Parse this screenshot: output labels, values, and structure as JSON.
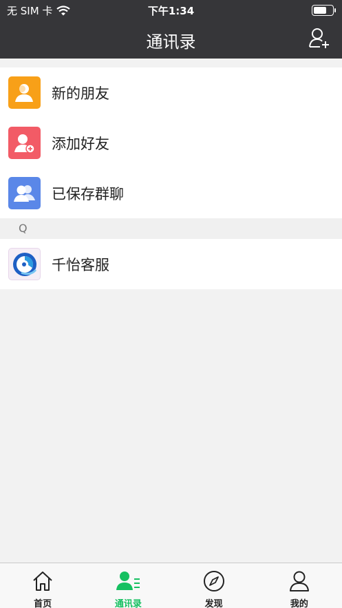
{
  "status_bar": {
    "carrier": "无 SIM 卡",
    "time": "下午1:34"
  },
  "nav": {
    "title": "通讯录",
    "add_icon": "add-contact-icon"
  },
  "contacts_menu": [
    {
      "label": "新的朋友",
      "icon": "new-friends-icon",
      "color": "#f8a018"
    },
    {
      "label": "添加好友",
      "icon": "add-friend-icon",
      "color": "#f25b66"
    },
    {
      "label": "已保存群聊",
      "icon": "group-chat-icon",
      "color": "#5a87e8"
    }
  ],
  "section": {
    "index_letter": "Q"
  },
  "contacts": [
    {
      "name": "千怡客服",
      "avatar": "customer-service-avatar"
    }
  ],
  "tabs": [
    {
      "label": "首页",
      "icon": "home-icon",
      "active": false
    },
    {
      "label": "通讯录",
      "icon": "contacts-icon",
      "active": true
    },
    {
      "label": "发现",
      "icon": "compass-icon",
      "active": false
    },
    {
      "label": "我的",
      "icon": "profile-icon",
      "active": false
    }
  ],
  "colors": {
    "header_bg": "#363639",
    "accent": "#16c061",
    "page_bg": "#f2f2f2"
  }
}
